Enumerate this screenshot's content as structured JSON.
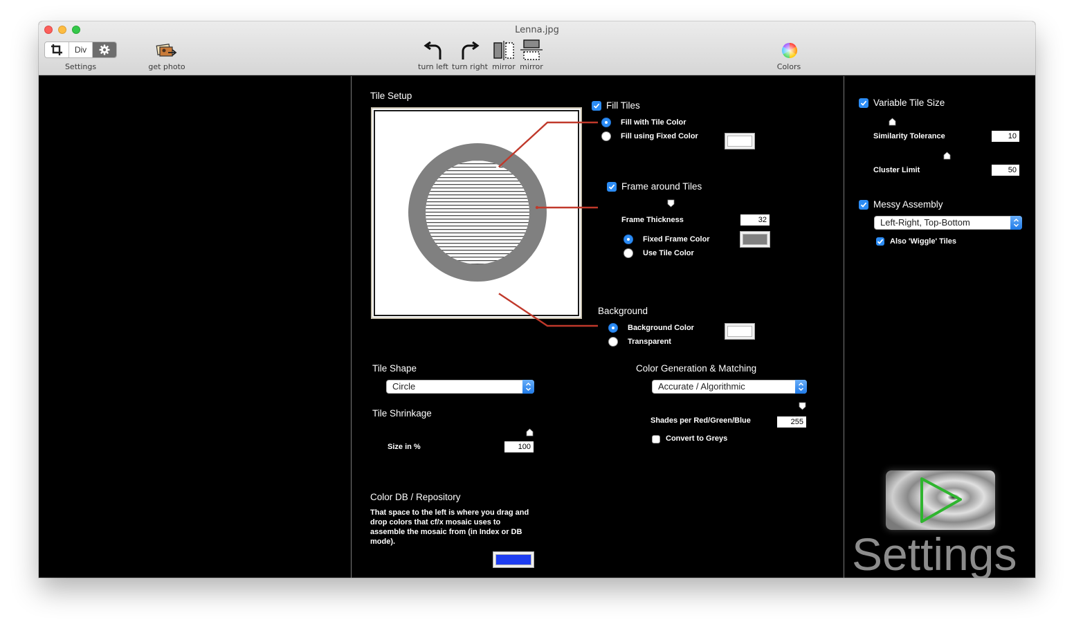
{
  "window": {
    "title": "Lenna.jpg"
  },
  "toolbar": {
    "settings_label": "Settings",
    "seg_div": "Div",
    "get_photo_label": "get photo",
    "turn_left_label": "turn left",
    "turn_right_label": "turn right",
    "mirror1_label": "mirror",
    "mirror2_label": "mirror",
    "colors_label": "Colors"
  },
  "tile_setup": {
    "title": "Tile Setup",
    "fill_tiles": "Fill Tiles",
    "fill_with_tile_color": "Fill with Tile Color",
    "fill_fixed_color": "Fill using Fixed Color",
    "frame_around_tiles": "Frame around Tiles",
    "frame_thickness_label": "Frame Thickness",
    "frame_thickness_value": "32",
    "fixed_frame_color": "Fixed Frame Color",
    "use_tile_color": "Use Tile Color",
    "background_title": "Background",
    "background_color": "Background Color",
    "transparent": "Transparent"
  },
  "tile_shape": {
    "title": "Tile Shape",
    "selected": "Circle"
  },
  "tile_shrinkage": {
    "title": "Tile Shrinkage",
    "size_label": "Size in %",
    "size_value": "100"
  },
  "color_gen": {
    "title": "Color Generation & Matching",
    "selected": "Accurate / Algorithmic",
    "shades_label": "Shades per Red/Green/Blue",
    "shades_value": "255",
    "convert_greys": "Convert to Greys"
  },
  "color_db": {
    "title": "Color DB / Repository",
    "description_line1": "That space to the left is where you drag and",
    "description_line2": "drop colors that cf/x mosaic uses to",
    "description_line3": "assemble the mosaic from (in Index or DB",
    "description_line4": "mode)."
  },
  "right_panel": {
    "variable_tile_size": "Variable Tile Size",
    "similarity_label": "Similarity Tolerance",
    "similarity_value": "10",
    "cluster_label": "Cluster Limit",
    "cluster_value": "50",
    "messy_assembly": "Messy Assembly",
    "assembly_order": "Left-Right, Top-Bottom",
    "wiggle": "Also 'Wiggle' Tiles",
    "big_settings": "Settings"
  },
  "colors": {
    "accent_blue": "#2c8cf4",
    "frame_grey": "#808080",
    "callout_red": "#c0392b",
    "db_swatch_blue": "#1e3df0"
  }
}
